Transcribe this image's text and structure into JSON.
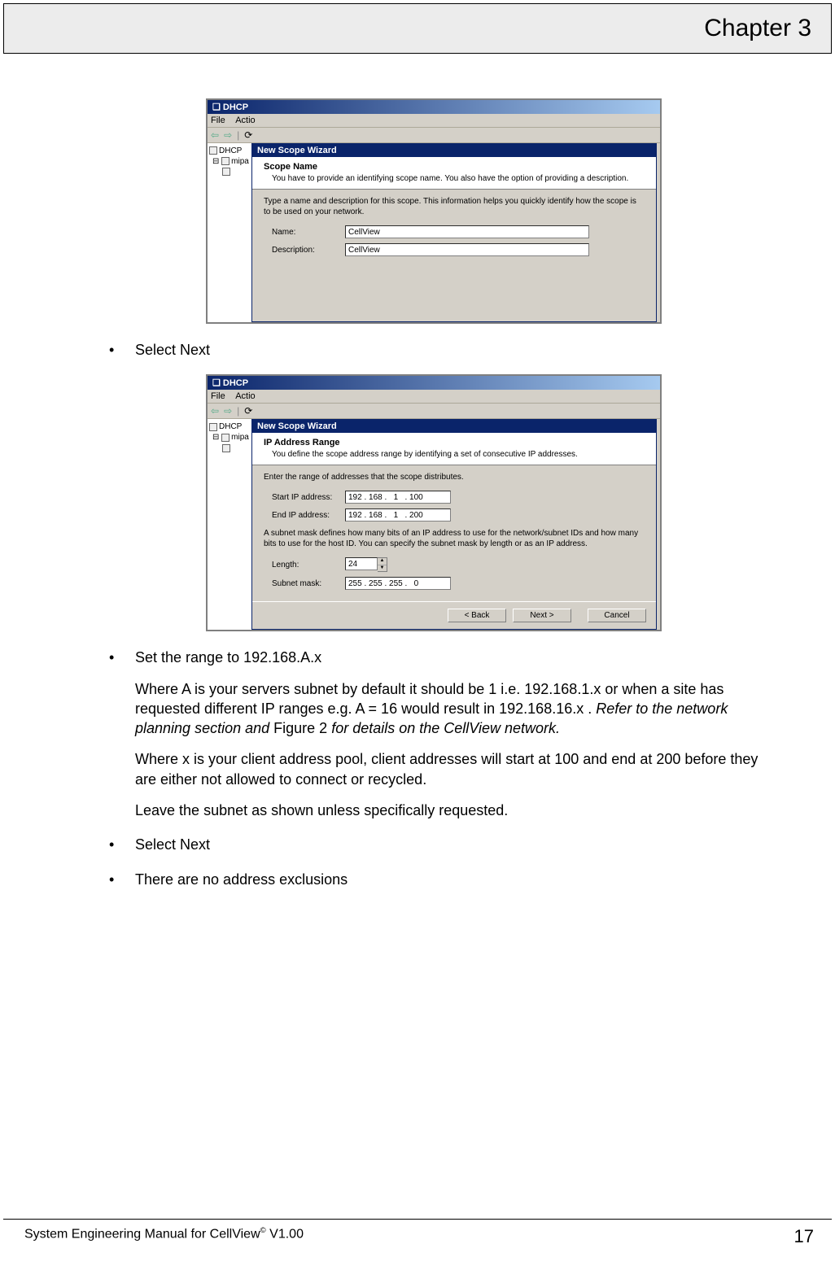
{
  "header": {
    "chapter": "Chapter 3"
  },
  "screenshot1": {
    "app_title": "DHCP",
    "menu": {
      "file": "File",
      "action": "Actio"
    },
    "tree": {
      "root": "DHCP",
      "node": "mipa",
      "leaf": ""
    },
    "wizard_title": "New Scope Wizard",
    "scope_name_heading": "Scope Name",
    "scope_name_sub": "You have to provide an identifying scope name. You also have the option of providing a description.",
    "instruction": "Type a name and description for this scope. This information helps you quickly identify how the scope is to be used on your network.",
    "name_label": "Name:",
    "name_value": "CellView",
    "desc_label": "Description:",
    "desc_value": "CellView"
  },
  "bullets_top": {
    "select_next": "Select Next"
  },
  "screenshot2": {
    "app_title": "DHCP",
    "menu": {
      "file": "File",
      "action": "Actio"
    },
    "tree": {
      "root": "DHCP",
      "node": "mipa",
      "leaf": ""
    },
    "wizard_title": "New Scope Wizard",
    "heading": "IP Address Range",
    "sub": "You define the scope address range by identifying a set of consecutive IP addresses.",
    "instruction1": "Enter the range of addresses that the scope distributes.",
    "start_label": "Start IP address:",
    "start_value": "192 . 168 .   1   . 100",
    "end_label": "End IP address:",
    "end_value": "192 . 168 .   1   . 200",
    "instruction2": "A subnet mask defines how many bits of an IP address to use for the network/subnet IDs and how many bits to use for the host ID. You can specify the subnet mask by length or as an IP address.",
    "length_label": "Length:",
    "length_value": "24",
    "mask_label": "Subnet mask:",
    "mask_value": "255 . 255 . 255 .   0",
    "buttons": {
      "back": "< Back",
      "next": "Next >",
      "cancel": "Cancel"
    }
  },
  "bullets_bottom": {
    "b1": "Set the range to 192.168.A.x",
    "b1_p1a": "Where A is your servers subnet by default it should be 1 i.e. 192.168.1.x or when a site has requested different IP ranges e.g. A = 16 would result in 192.168.16.x . ",
    "b1_p1b": "Refer to the network planning section and ",
    "b1_p1c": "Figure 2",
    "b1_p1d": " for details on the CellView network.",
    "b1_p2": "Where x is your client address pool, client addresses will start at 100 and end at 200 before they are either not allowed to connect or recycled.",
    "b1_p3": "Leave the subnet as shown unless specifically requested.",
    "b2": "Select Next",
    "b3": "There are no address exclusions"
  },
  "footer": {
    "doc_title_a": "System Engineering Manual for CellView",
    "doc_title_b": " V1.00",
    "page": "17"
  }
}
